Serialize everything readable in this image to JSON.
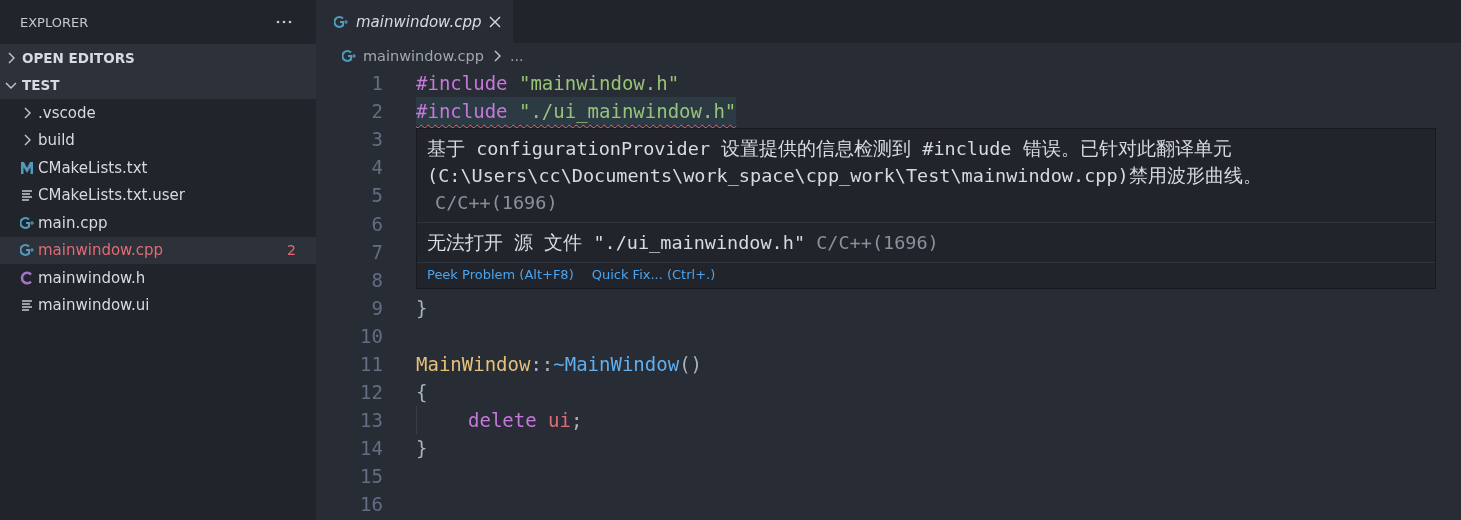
{
  "sidebar": {
    "title": "EXPLORER",
    "sections": [
      {
        "label": "OPEN EDITORS",
        "expanded": false
      },
      {
        "label": "TEST",
        "expanded": true,
        "children": [
          {
            "label": ".vscode",
            "kind": "folder",
            "expanded": false,
            "selected": false,
            "error": false
          },
          {
            "label": "build",
            "kind": "folder",
            "expanded": false,
            "selected": false,
            "error": false
          },
          {
            "label": "CMakeLists.txt",
            "kind": "cmake",
            "selected": false,
            "error": false
          },
          {
            "label": "CMakeLists.txt.user",
            "kind": "text",
            "selected": false,
            "error": false
          },
          {
            "label": "main.cpp",
            "kind": "cpp",
            "selected": false,
            "error": false
          },
          {
            "label": "mainwindow.cpp",
            "kind": "cpp",
            "selected": true,
            "error": true,
            "badge": "2"
          },
          {
            "label": "mainwindow.h",
            "kind": "header",
            "selected": false,
            "error": false
          },
          {
            "label": "mainwindow.ui",
            "kind": "text",
            "selected": false,
            "error": false
          }
        ]
      }
    ]
  },
  "tabs": [
    {
      "label": "mainwindow.cpp",
      "kind": "cpp",
      "selected": true,
      "preview": true
    }
  ],
  "breadcrumb": {
    "kind": "cpp",
    "items": [
      "mainwindow.cpp",
      "..."
    ]
  },
  "code": [
    {
      "number": "1",
      "error": false,
      "tokens": [
        {
          "text": "#include",
          "kind": "keyword"
        },
        {
          "text": " \"mainwindow.h\"",
          "kind": "string"
        }
      ]
    },
    {
      "number": "2",
      "error": true,
      "tokens": [
        {
          "text": "#include",
          "kind": "keyword"
        },
        {
          "text": " \"./ui_mainwindow.h\"",
          "kind": "string"
        }
      ]
    },
    {
      "number": "3"
    },
    {
      "number": "4"
    },
    {
      "number": "5"
    },
    {
      "number": "6"
    },
    {
      "number": "7"
    },
    {
      "number": "8"
    },
    {
      "number": "9",
      "error": false,
      "tokens": [
        {
          "text": "}",
          "kind": "punct"
        }
      ]
    },
    {
      "number": "10"
    },
    {
      "number": "11",
      "error": false,
      "tokens": [
        {
          "text": "MainWindow",
          "kind": "type"
        },
        {
          "text": "::",
          "kind": "punct"
        },
        {
          "text": "~MainWindow",
          "kind": "function"
        },
        {
          "text": "()",
          "kind": "punct"
        }
      ]
    },
    {
      "number": "12",
      "error": false,
      "tokens": [
        {
          "text": "{",
          "kind": "punct"
        }
      ]
    },
    {
      "number": "13",
      "error": false,
      "indent": true,
      "tokens": [
        {
          "text": "delete",
          "kind": "keyword"
        },
        {
          "text": " ui",
          "kind": "variable"
        },
        {
          "text": ";",
          "kind": "punct"
        }
      ]
    },
    {
      "number": "14",
      "error": false,
      "tokens": [
        {
          "text": "}",
          "kind": "punct"
        }
      ]
    },
    {
      "number": "15"
    },
    {
      "number": "16"
    }
  ],
  "hover": {
    "messages": [
      {
        "text": "基于 configurationProvider 设置提供的信息检测到 #include 错误。已针对此翻译单元 (C:\\Users\\cc\\Documents\\work_space\\cpp_work\\Test\\mainwindow.cpp)禁用波形曲线。",
        "source": "C/C++(1696)",
        "source_on_new_line": true
      },
      {
        "text": "无法打开 源 文件 \"./ui_mainwindow.h\"",
        "source": "C/C++(1696)",
        "source_on_new_line": false
      }
    ],
    "actions": [
      "Peek Problem (Alt+F8)",
      "Quick Fix... (Ctrl+.)"
    ]
  }
}
